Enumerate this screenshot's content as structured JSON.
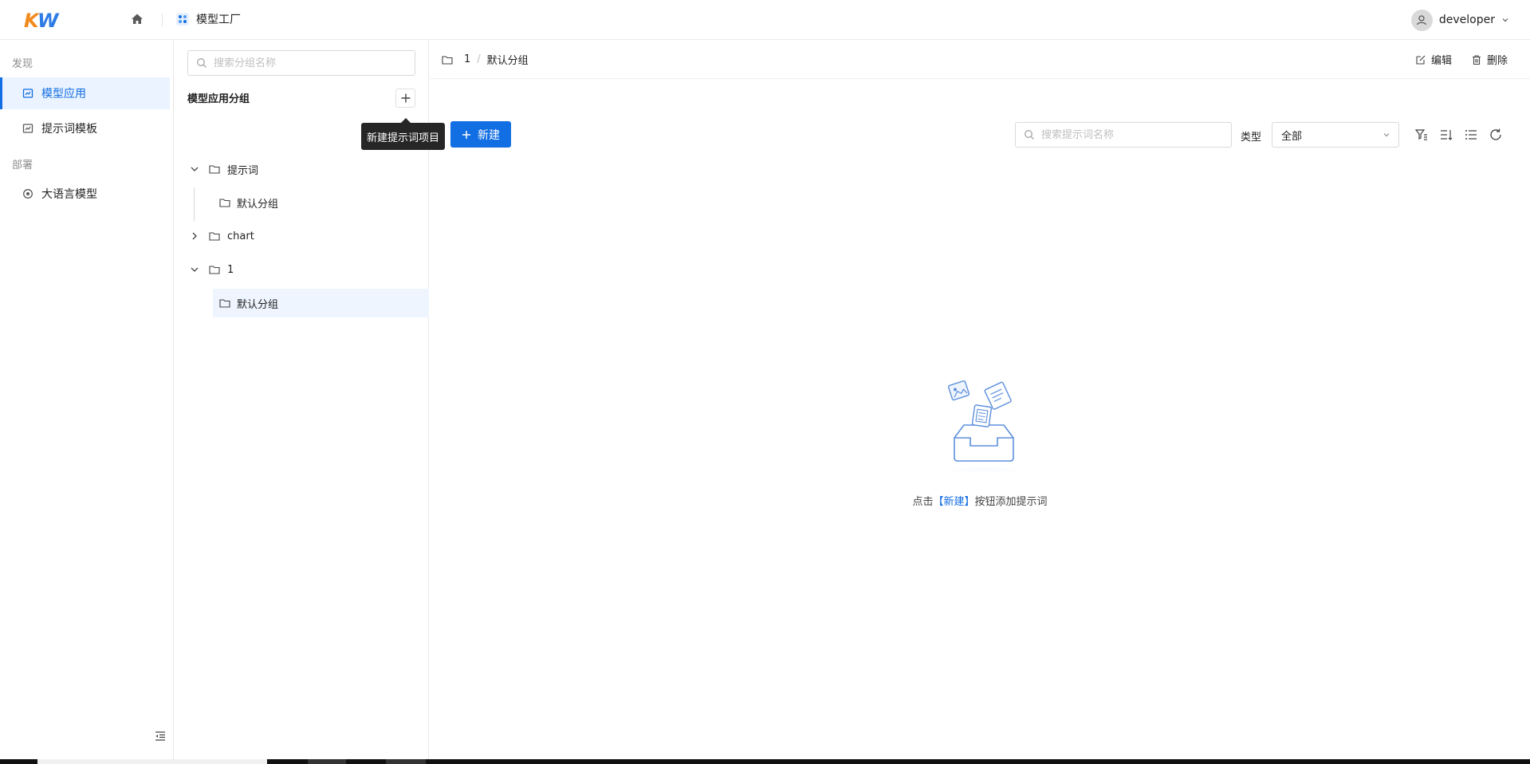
{
  "header": {
    "logo_text": "KW",
    "app_name": "模型工厂",
    "user_name": "developer",
    "home_icon": "home-icon",
    "user_icon": "user-icon"
  },
  "nav": {
    "section_discover": "发现",
    "section_deploy": "部署",
    "items": [
      {
        "label": "模型应用",
        "icon": "app-icon",
        "active": true
      },
      {
        "label": "提示词模板",
        "icon": "template-icon",
        "active": false
      },
      {
        "label": "大语言模型",
        "icon": "model-icon",
        "active": false
      }
    ]
  },
  "groups": {
    "search_placeholder": "搜索分组名称",
    "title": "模型应用分组",
    "tooltip": "新建提示词项目",
    "tree": [
      {
        "label": "提示词",
        "expanded": true,
        "children": [
          {
            "label": "默认分组"
          }
        ]
      },
      {
        "label": "chart",
        "expanded": false,
        "children": []
      },
      {
        "label": "1",
        "expanded": true,
        "children": [
          {
            "label": "默认分组",
            "selected": true
          }
        ]
      }
    ]
  },
  "main": {
    "breadcrumb": {
      "parent": "1",
      "current": "默认分组"
    },
    "actions": {
      "edit": "编辑",
      "delete": "删除"
    },
    "new_button": "新建",
    "search_placeholder": "搜索提示词名称",
    "type_label": "类型",
    "type_value": "全部",
    "empty": {
      "prefix": "点击",
      "link": "【新建】",
      "suffix": "按钮添加提示词"
    }
  },
  "colors": {
    "accent": "#126ee3",
    "active_bg": "#eaf3ff",
    "selected_bg": "#eef5ff"
  }
}
